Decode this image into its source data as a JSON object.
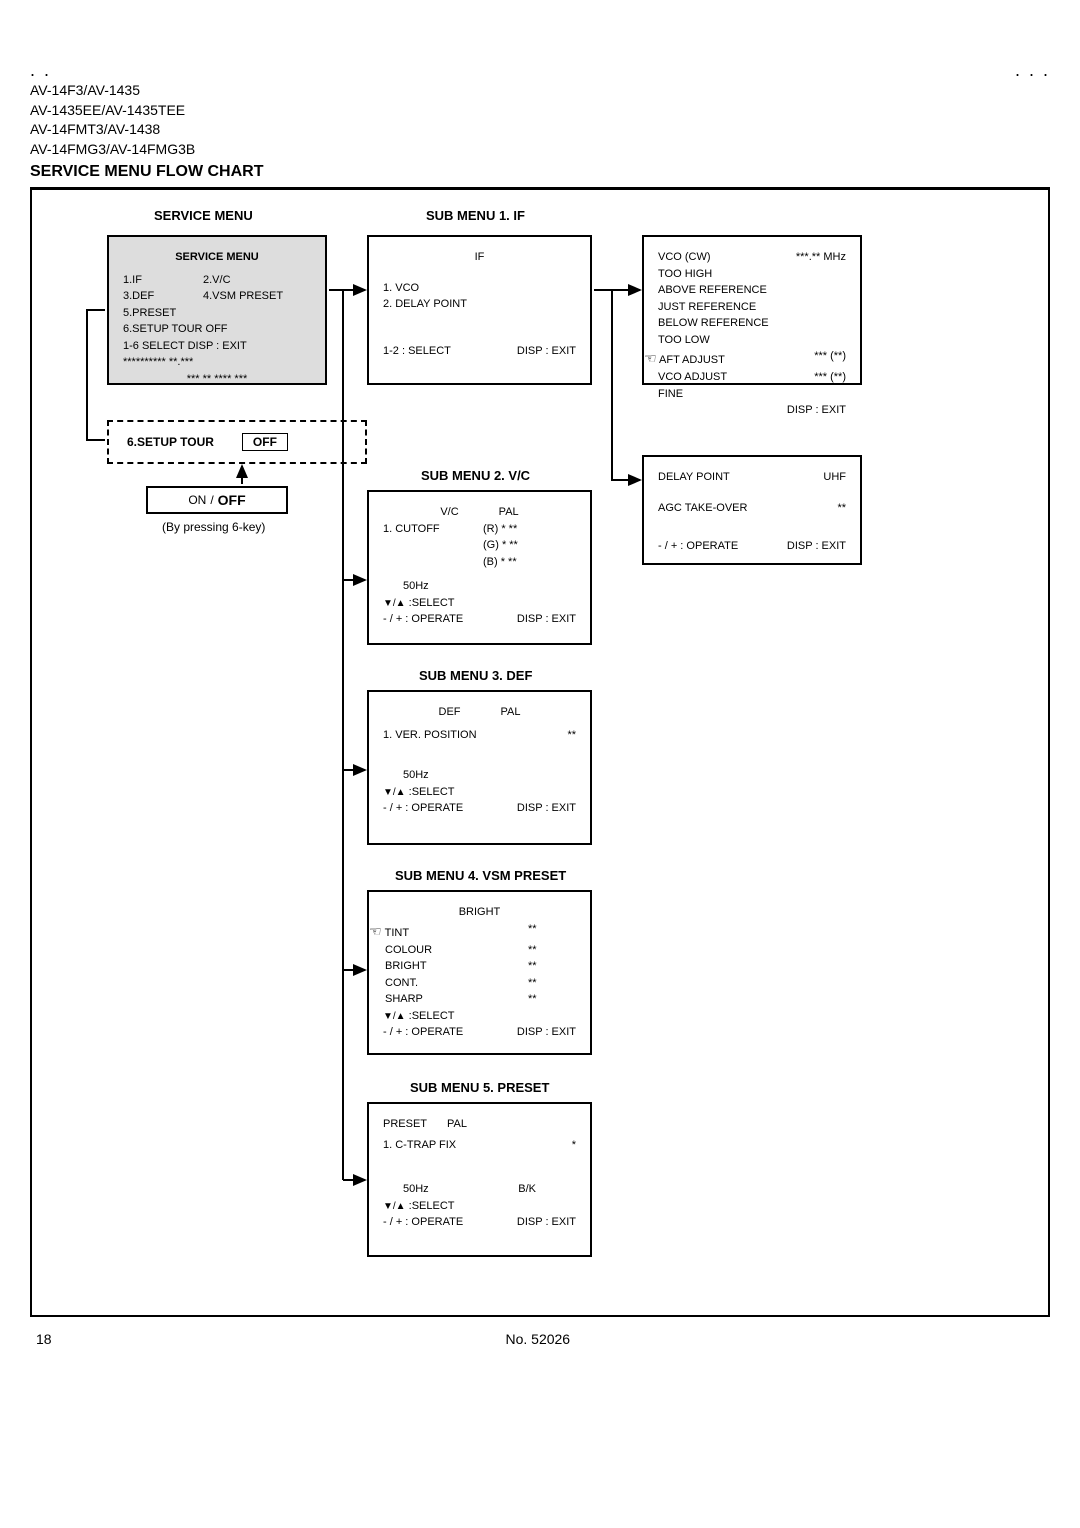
{
  "header": {
    "dots_left": ". .",
    "dots_right": ". . .",
    "models": [
      "AV-14F3/AV-1435",
      "AV-1435EE/AV-1435TEE",
      "AV-14FMT3/AV-1438",
      "AV-14FMG3/AV-14FMG3B"
    ],
    "title": "SERVICE MENU FLOW CHART"
  },
  "labels": {
    "service_menu": "SERVICE MENU",
    "sub1": "SUB MENU 1. IF",
    "sub2": "SUB MENU 2. V/C",
    "sub3": "SUB MENU 3. DEF",
    "sub4": "SUB MENU 4. VSM PRESET",
    "sub5": "SUB MENU 5. PRESET"
  },
  "service_box": {
    "hdr": "SERVICE MENU",
    "items": [
      [
        "1.IF",
        "2.V/C"
      ],
      [
        "3.DEF",
        "4.VSM PRESET"
      ],
      [
        "5.PRESET",
        ""
      ],
      [
        "6.SETUP TOUR OFF",
        ""
      ]
    ],
    "controls": "1-6 SELECT    DISP : EXIT",
    "stars1": "**********   **.***",
    "stars2": "***  **  ****  ***"
  },
  "setup_tour": {
    "label": "6.SETUP TOUR",
    "off": "OFF",
    "on": "ON",
    "slash": "/",
    "offbold": "OFF",
    "note": "(By pressing 6-key)"
  },
  "sub1": {
    "hdr": "IF",
    "i1": "1. VCO",
    "i2": "2. DELAY POINT",
    "c1": "1-2 : SELECT",
    "c2": "DISP : EXIT"
  },
  "vco": {
    "l1a": "VCO (CW)",
    "l1b": "***.** MHz",
    "l2": "TOO HIGH",
    "l3": "ABOVE REFERENCE",
    "l4": "JUST REFERENCE",
    "l5": "BELOW REFERENCE",
    "l6": "TOO LOW",
    "l7a": "AFT ADJUST",
    "l7b": "*** (**)",
    "l8a": "VCO ADJUST",
    "l8b": "*** (**)",
    "l9": "FINE",
    "exit": "DISP : EXIT"
  },
  "delay": {
    "l1a": "DELAY POINT",
    "l1b": "UHF",
    "l2a": "AGC TAKE-OVER",
    "l2b": "**",
    "c1": "- / + : OPERATE",
    "c2": "DISP : EXIT"
  },
  "sub2": {
    "h1": "V/C",
    "h2": "PAL",
    "i1": "1. CUTOFF",
    "rgbR": "(R) * **",
    "rgbG": "(G) * **",
    "rgbB": "(B) * **",
    "hz": "50Hz",
    "sel": ":SELECT",
    "op": "- / + : OPERATE",
    "exit": "DISP : EXIT"
  },
  "sub3": {
    "h1": "DEF",
    "h2": "PAL",
    "i1": "1. VER. POSITION",
    "v1": "**",
    "hz": "50Hz",
    "sel": ":SELECT",
    "op": "- / + : OPERATE",
    "exit": "DISP : EXIT"
  },
  "sub4": {
    "h1": "BRIGHT",
    "r1a": "TINT",
    "r1b": "**",
    "r2a": "COLOUR",
    "r2b": "**",
    "r3a": "BRIGHT",
    "r3b": "**",
    "r4a": "CONT.",
    "r4b": "**",
    "r5a": "SHARP",
    "r5b": "**",
    "sel": ":SELECT",
    "op": "- / + : OPERATE",
    "exit": "DISP : EXIT"
  },
  "sub5": {
    "h1": "PRESET",
    "h2": "PAL",
    "i1": "1. C-TRAP FIX",
    "v1": "*",
    "hz": "50Hz",
    "bk": "B/K",
    "sel": ":SELECT",
    "op": "- / + : OPERATE",
    "exit": "DISP : EXIT"
  },
  "footer": {
    "page": "18",
    "doc": "No. 52026"
  }
}
